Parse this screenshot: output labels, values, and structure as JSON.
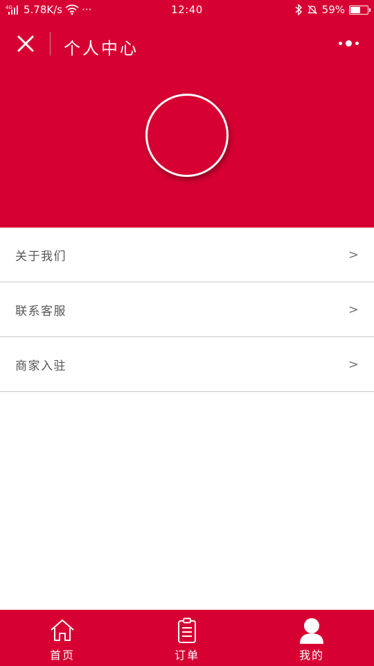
{
  "status_bar": {
    "network": "4G",
    "speed": "5.78K/s",
    "extra": "···",
    "time": "12:40",
    "battery_percent": "59%",
    "battery_level": 0.59
  },
  "header": {
    "title": "个人中心"
  },
  "menu": {
    "items": [
      {
        "label": "关于我们",
        "arrow": ">"
      },
      {
        "label": "联系客服",
        "arrow": ">"
      },
      {
        "label": "商家入驻",
        "arrow": ">"
      }
    ]
  },
  "tab_bar": {
    "tabs": [
      {
        "label": "首页",
        "icon": "home-icon"
      },
      {
        "label": "订单",
        "icon": "clipboard-icon"
      },
      {
        "label": "我的",
        "icon": "user-icon"
      }
    ]
  },
  "colors": {
    "brand_red": "#d70032",
    "white": "#ffffff",
    "text_gray": "#555555",
    "divider": "#c8c8c8"
  }
}
